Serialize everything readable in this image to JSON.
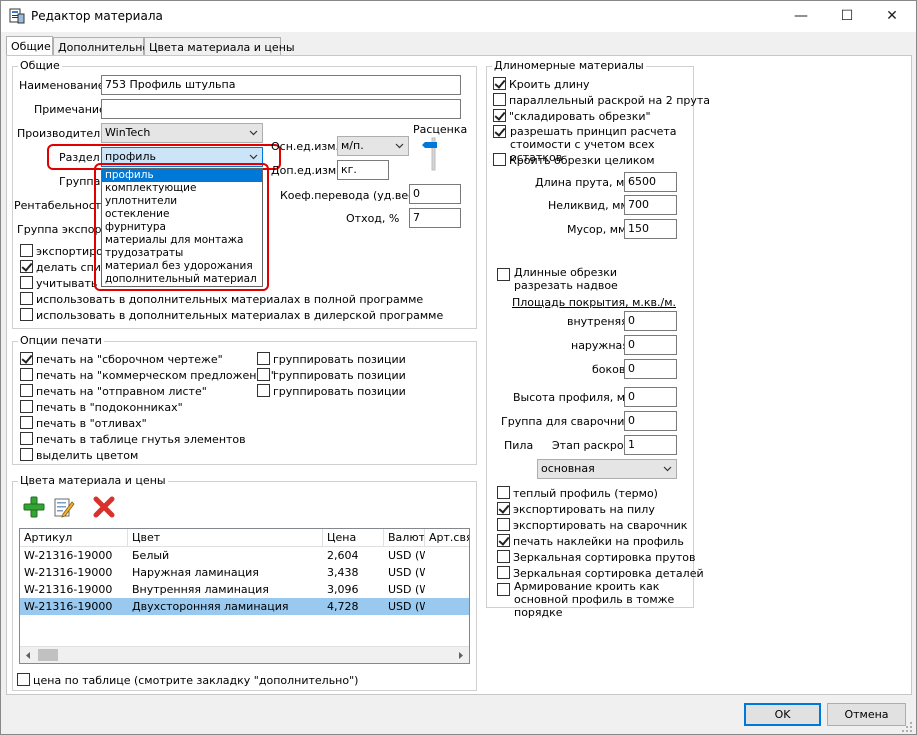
{
  "window": {
    "title": "Редактор материала",
    "minimize": "—",
    "maximize": "☐",
    "close": "✕"
  },
  "tabs": [
    "Общие",
    "Дополнительно",
    "Цвета материала и цены"
  ],
  "general": {
    "group_title": "Общие",
    "name_label": "Наименование",
    "name_value": "753 Профиль штульпа",
    "note_label": "Примечание",
    "note_value": "",
    "maker_label": "Производитель",
    "maker_value": "WinTech",
    "section_label": "Раздел",
    "section_value": "профиль",
    "group_label": "Группа",
    "profit_label": "Рентабельность",
    "export_group_label": "Группа экспорт",
    "unit_main_label": "Осн.ед.изм.",
    "unit_main_value": "м/п.",
    "unit_extra_label": "Доп.ед.изм.",
    "unit_extra_value": "кг.",
    "rate_label": "Расценка",
    "coef_label": "Коеф.перевода (уд.вес)",
    "coef_value": "0",
    "waste_label": "Отход, %",
    "waste_value": "7",
    "checkboxes": [
      {
        "label": "экспортиров",
        "checked": false
      },
      {
        "label": "делать спис",
        "checked": true
      },
      {
        "label": "учитывать",
        "checked": false
      },
      {
        "label": "использовать в дополнительных материалах в полной программе",
        "checked": false
      },
      {
        "label": "использовать в дополнительных материалах в дилерской программе",
        "checked": false
      }
    ],
    "section_options": [
      "профиль",
      "комплектующие",
      "уплотнители",
      "остекление",
      "фурнитура",
      "материалы для монтажа",
      "трудозатраты",
      "материал без удорожания",
      "дополнительный материал"
    ]
  },
  "print": {
    "group_title": "Опции печати",
    "left": [
      {
        "label": "печать на \"сборочном чертеже\"",
        "checked": true
      },
      {
        "label": "печать на \"коммерческом предложении\"",
        "checked": false
      },
      {
        "label": "печать на \"отправном листе\"",
        "checked": false
      },
      {
        "label": "печать в \"подоконниках\"",
        "checked": false
      },
      {
        "label": "печать в \"отливах\"",
        "checked": false
      },
      {
        "label": "печать в таблице гнутья элементов",
        "checked": false
      },
      {
        "label": "выделить цветом",
        "checked": false
      }
    ],
    "right": [
      {
        "label": "группировать позиции",
        "checked": false
      },
      {
        "label": "группировать позиции",
        "checked": false
      },
      {
        "label": "группировать позиции",
        "checked": false
      }
    ]
  },
  "colors": {
    "group_title": "Цвета материала и цены",
    "columns": [
      "Артикул",
      "Цвет",
      "Цена",
      "Валют",
      "Арт.свя"
    ],
    "rows": [
      [
        "W-21316-19000",
        "Белый",
        "2,604",
        "USD (W"
      ],
      [
        "W-21316-19000",
        "Наружная ламинация",
        "3,438",
        "USD (W"
      ],
      [
        "W-21316-19000",
        "Внутренняя ламинация",
        "3,096",
        "USD (W"
      ],
      [
        "W-21316-19000",
        "Двухсторонняя ламинация",
        "4,728",
        "USD (W"
      ]
    ],
    "price_table_label": "цена по таблице (смотрите закладку \"дополнительно\")"
  },
  "linear": {
    "group_title": "Длиномерные материалы",
    "checks": [
      {
        "label": "Кроить длину",
        "checked": true
      },
      {
        "label": "параллельный раскрой на 2 прута",
        "checked": false
      },
      {
        "label": "\"складировать обрезки\"",
        "checked": true
      },
      {
        "label": "разрешать принцип расчета стоимости с учетом всех остатков",
        "checked": true
      },
      {
        "label": "Кроить обрезки целиком",
        "checked": false
      }
    ],
    "bar_length_label": "Длина прута, мм.",
    "bar_length_value": "6500",
    "illiquid_label": "Неликвид, мм.",
    "illiquid_value": "700",
    "trash_label": "Мусор, мм.",
    "trash_value": "150",
    "long_cut_label": "Длинные обрезки разрезать надвое",
    "long_cut_checked": false,
    "area_label": "Площадь покрытия, м.кв./м.",
    "inner_label": "внутреняя",
    "inner_value": "0",
    "outer_label": "наружная",
    "outer_value": "0",
    "side_label": "боков",
    "side_value": "0",
    "height_label": "Высота профиля, мм.",
    "height_value": "0",
    "weld_group_label": "Группа для сварочника",
    "weld_group_value": "0",
    "saw_label": "Пила",
    "stage_label": "Этап раскроя",
    "stage_value": "1",
    "saw_value": "основная",
    "bottom_checks": [
      {
        "label": "теплый профиль (термо)",
        "checked": false
      },
      {
        "label": "экспортировать на пилу",
        "checked": true
      },
      {
        "label": "экспортировать на сварочник",
        "checked": false
      },
      {
        "label": "печать наклейки на профиль",
        "checked": true
      },
      {
        "label": "Зеркальная сортировка прутов",
        "checked": false
      },
      {
        "label": "Зеркальная сортировка деталей",
        "checked": false
      },
      {
        "label": "Армирование кроить как основной профиль в томже порядке",
        "checked": false
      }
    ]
  },
  "buttons": {
    "ok": "OK",
    "cancel": "Отмена"
  },
  "accent": "#0078d7",
  "highlight": "#e00000"
}
